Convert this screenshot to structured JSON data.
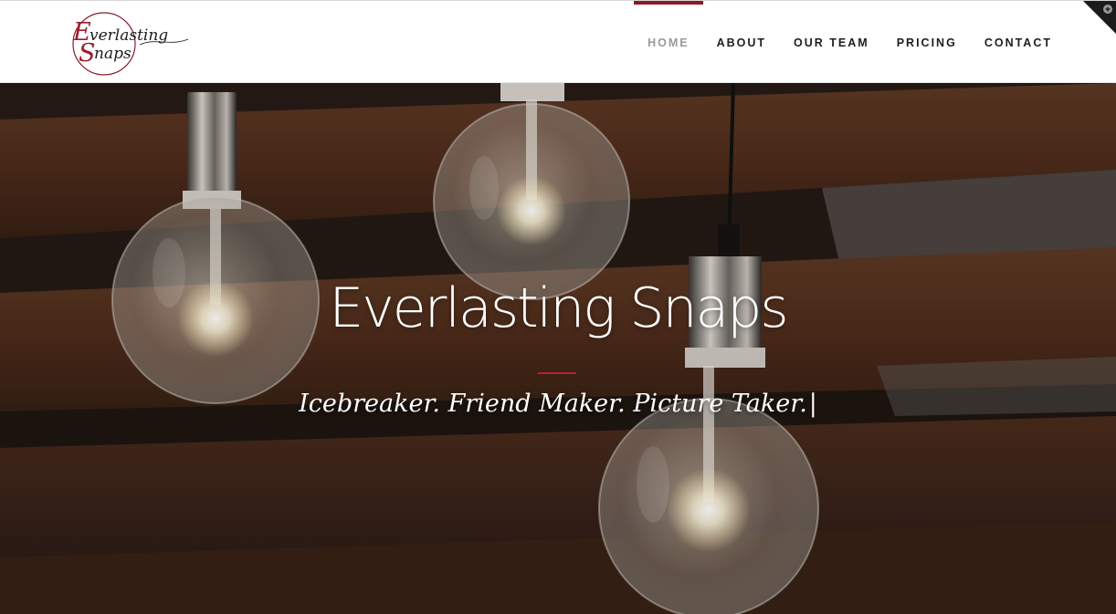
{
  "brand": {
    "logo_line1": "Everlasting",
    "logo_line2": "Snaps",
    "accent_color": "#8b1a2b"
  },
  "nav": {
    "items": [
      {
        "label": "HOME",
        "active": true
      },
      {
        "label": "ABOUT",
        "active": false
      },
      {
        "label": "OUR TEAM",
        "active": false
      },
      {
        "label": "PRICING",
        "active": false
      },
      {
        "label": "CONTACT",
        "active": false
      }
    ]
  },
  "corner_toggle": {
    "icon": "plus-circle-icon"
  },
  "hero": {
    "title": "Everlasting Snaps",
    "tagline": "Icebreaker. Friend Maker. Picture Taker.",
    "cursor": "|",
    "background": "pendant-edison-bulbs-photo",
    "divider_color": "#b3232f"
  }
}
